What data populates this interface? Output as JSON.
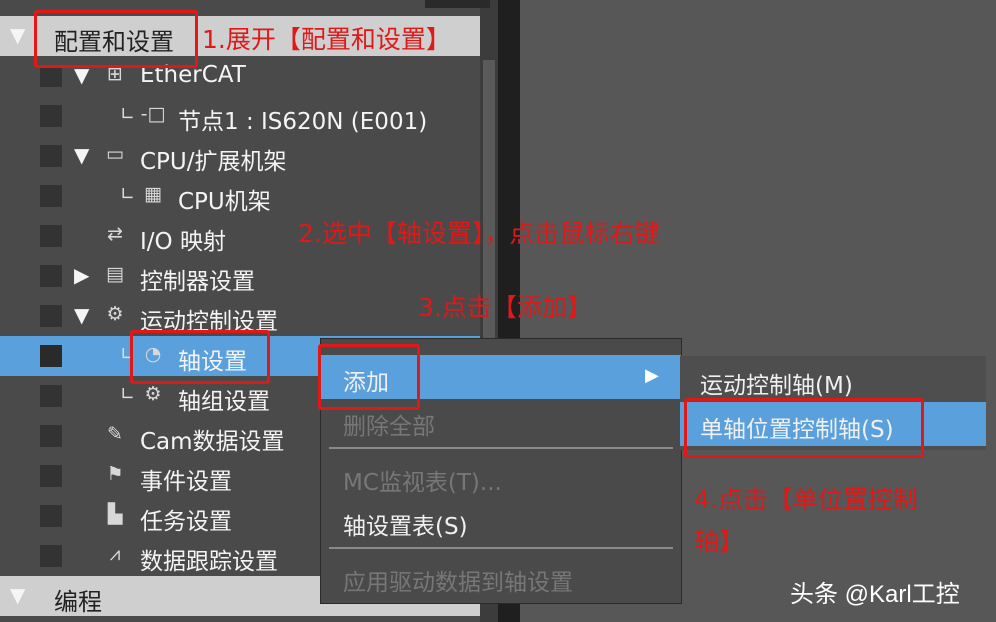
{
  "tree": {
    "section_config": "配置和设置",
    "section_programming": "编程",
    "items": [
      {
        "label": "EtherCAT",
        "icon": "network-icon"
      },
      {
        "label": "节点1 : IS620N (E001)",
        "icon": "node-icon"
      },
      {
        "label": "CPU/扩展机架",
        "icon": "cpu-rack-icon"
      },
      {
        "label": "CPU机架",
        "icon": "rack-icon"
      },
      {
        "label": "I/O 映射",
        "icon": "io-map-icon"
      },
      {
        "label": "控制器设置",
        "icon": "controller-icon"
      },
      {
        "label": "运动控制设置",
        "icon": "gear-icon"
      },
      {
        "label": "轴设置",
        "icon": "axis-icon"
      },
      {
        "label": "轴组设置",
        "icon": "axis-group-icon"
      },
      {
        "label": "Cam数据设置",
        "icon": "cam-icon"
      },
      {
        "label": "事件设置",
        "icon": "flag-icon"
      },
      {
        "label": "任务设置",
        "icon": "task-icon"
      },
      {
        "label": "数据跟踪设置",
        "icon": "trace-icon"
      }
    ]
  },
  "context_menu": {
    "add": "添加",
    "delete": "删除全部",
    "mc_monitor": "MC监视表(T)...",
    "axis_table": "轴设置表(S)",
    "apply_drive": "应用驱动数据到轴设置"
  },
  "submenu": {
    "motion_axis": "运动控制轴(M)",
    "single_axis": "单轴位置控制轴(S)"
  },
  "annotations": {
    "step1": "1.展开【配置和设置】",
    "step2": "2.选中【轴设置】，点击鼠标右键",
    "step3": "3.点击【添加】",
    "step4_line1": "4.点击【单位置控制",
    "step4_line2": "轴】"
  },
  "watermark": "头条 @Karl工控",
  "colors": {
    "selection": "#5aa0dc",
    "annotation_red": "#e01818",
    "panel_bg": "#4a4a4a"
  }
}
